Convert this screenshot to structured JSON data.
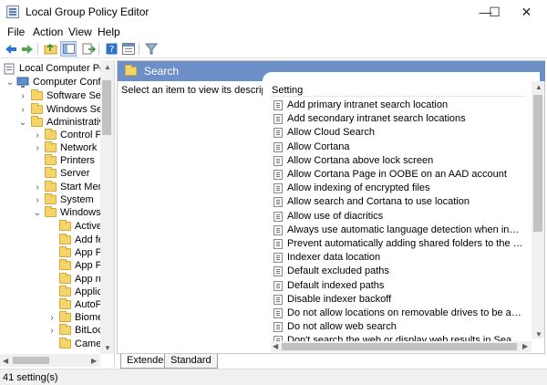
{
  "window": {
    "title": "Local Group Policy Editor",
    "controls": [
      "—",
      "☐",
      "✕"
    ]
  },
  "menu": [
    "File",
    "Action",
    "View",
    "Help"
  ],
  "tree": [
    {
      "label": "Local Computer Policy",
      "indent": 0,
      "arrow": ""
    },
    {
      "label": "Computer Configuration",
      "indent": 1,
      "arrow": "⌄"
    },
    {
      "label": "Software Settings",
      "indent": 2,
      "arrow": "›"
    },
    {
      "label": "Windows Settings",
      "indent": 2,
      "arrow": "›"
    },
    {
      "label": "Administrative Templates",
      "indent": 2,
      "arrow": "⌄"
    },
    {
      "label": "Control Panel",
      "indent": 3,
      "arrow": "›"
    },
    {
      "label": "Network",
      "indent": 3,
      "arrow": "›"
    },
    {
      "label": "Printers",
      "indent": 3,
      "arrow": ""
    },
    {
      "label": "Server",
      "indent": 3,
      "arrow": ""
    },
    {
      "label": "Start Menu",
      "indent": 3,
      "arrow": "›"
    },
    {
      "label": "System",
      "indent": 3,
      "arrow": "›"
    },
    {
      "label": "Windows Components",
      "indent": 3,
      "arrow": "⌄"
    },
    {
      "label": "ActiveX",
      "indent": 4,
      "arrow": ""
    },
    {
      "label": "Add features",
      "indent": 4,
      "arrow": ""
    },
    {
      "label": "App Package",
      "indent": 4,
      "arrow": ""
    },
    {
      "label": "App Privacy",
      "indent": 4,
      "arrow": ""
    },
    {
      "label": "App runtime",
      "indent": 4,
      "arrow": ""
    },
    {
      "label": "Application",
      "indent": 4,
      "arrow": ""
    },
    {
      "label": "AutoPlay",
      "indent": 4,
      "arrow": ""
    },
    {
      "label": "Biometrics",
      "indent": 4,
      "arrow": "›"
    },
    {
      "label": "BitLocker",
      "indent": 4,
      "arrow": "›"
    },
    {
      "label": "Camera",
      "indent": 4,
      "arrow": ""
    }
  ],
  "panel": {
    "header": "Search",
    "description": "Select an item to view its description.",
    "column_header": "Setting"
  },
  "settings": [
    "Add primary intranet search location",
    "Add secondary intranet search locations",
    "Allow Cloud Search",
    "Allow Cortana",
    "Allow Cortana above lock screen",
    "Allow Cortana Page in OOBE on an AAD account",
    "Allow indexing of encrypted files",
    "Allow search and Cortana to use location",
    "Allow use of diacritics",
    "Always use automatic language detection when indexing con...",
    "Prevent automatically adding shared folders to the Windows ...",
    "Indexer data location",
    "Default excluded paths",
    "Default indexed paths",
    "Disable indexer backoff",
    "Do not allow locations on removable drives to be added to li...",
    "Do not allow web search",
    "Don't search the web or display web results in Search"
  ],
  "tabs": [
    "Extended",
    "Standard"
  ],
  "status": "41 setting(s)"
}
